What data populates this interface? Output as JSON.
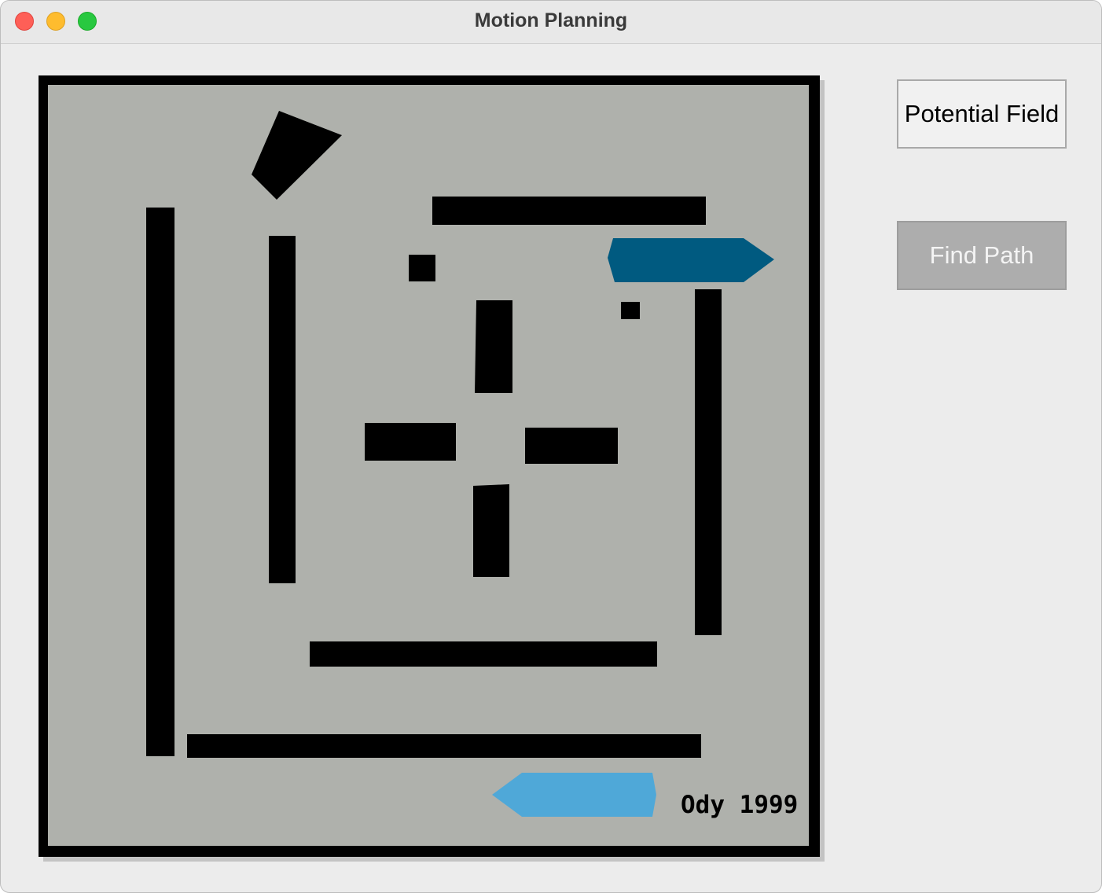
{
  "window": {
    "title": "Motion Planning"
  },
  "controls": {
    "potential_field_label": "Potential Field",
    "find_path_label": "Find Path"
  },
  "workspace": {
    "signature": "Ody 1999"
  },
  "colors": {
    "workspace_background": "#afb1ac",
    "workspace_border": "#000000",
    "obstacle": "#000000",
    "start_robot": "#005a80",
    "goal_robot": "#4fa8d8"
  }
}
